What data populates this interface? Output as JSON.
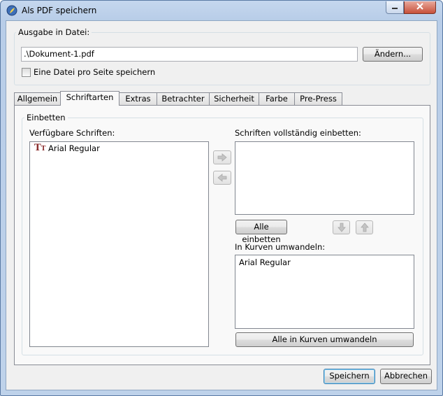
{
  "window": {
    "title": "Als PDF speichern",
    "minimize_icon": "minimize-icon",
    "close_icon": "close-icon"
  },
  "output": {
    "group_label": "Ausgabe in Datei:",
    "file_value": ".\\Dokument-1.pdf",
    "change_button": "Ändern...",
    "one_file_per_page_label": "Eine Datei pro Seite speichern",
    "one_file_per_page_checked": false
  },
  "tabs": [
    {
      "label": "Allgemein",
      "active": false
    },
    {
      "label": "Schriftarten",
      "active": true
    },
    {
      "label": "Extras",
      "active": false
    },
    {
      "label": "Betrachter",
      "active": false
    },
    {
      "label": "Sicherheit",
      "active": false
    },
    {
      "label": "Farbe",
      "active": false
    },
    {
      "label": "Pre-Press",
      "active": false
    }
  ],
  "embed": {
    "group_label": "Einbetten",
    "available_label": "Verfügbare Schriften:",
    "available_fonts": [
      "Arial Regular"
    ],
    "full_embed_label": "Schriften vollständig einbetten:",
    "full_embed_fonts": [],
    "embed_all_button": "Alle einbetten",
    "outline_label": "In Kurven umwandeln:",
    "outline_fonts": [
      "Arial Regular"
    ],
    "outline_all_button": "Alle in Kurven umwandeln"
  },
  "footer": {
    "save_button": "Speichern",
    "cancel_button": "Abbrechen"
  },
  "colors": {
    "accent": "#3c7fb1",
    "font_icon": "#8a2d2d"
  }
}
